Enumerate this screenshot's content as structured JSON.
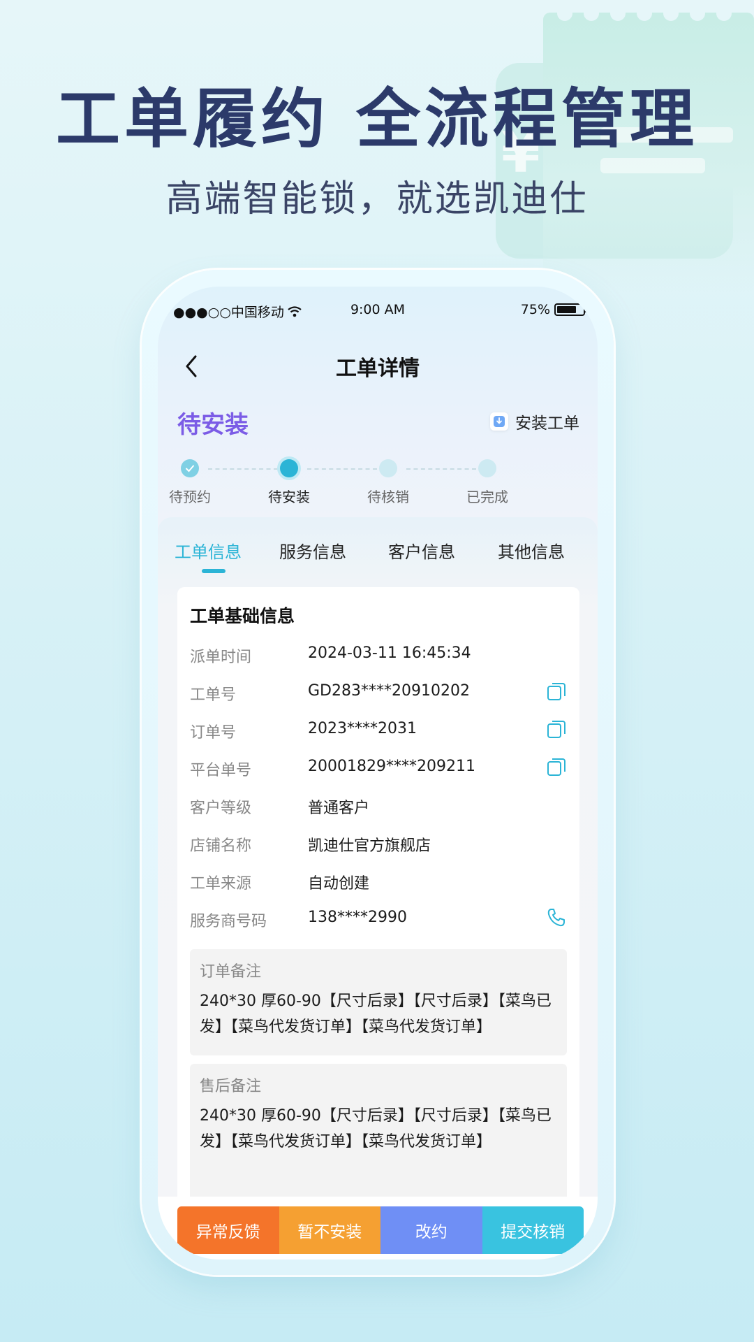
{
  "promo": {
    "headline": "工单履约  全流程管理",
    "subline": "高端智能锁，就选凯迪仕"
  },
  "status_bar": {
    "carrier": "●●●○○中国移动",
    "time": "9:00 AM",
    "battery": "75%",
    "battery_level": 0.75
  },
  "nav": {
    "title": "工单详情",
    "back_icon": "chevron-left-icon"
  },
  "order_status": {
    "title": "待安装",
    "type_label": "安装工单",
    "type_icon": "download-box-icon"
  },
  "steps": [
    {
      "label": "待预约",
      "state": "done"
    },
    {
      "label": "待安装",
      "state": "active"
    },
    {
      "label": "待核销",
      "state": "pending"
    },
    {
      "label": "已完成",
      "state": "pending"
    }
  ],
  "tabs": [
    {
      "label": "工单信息",
      "active": true
    },
    {
      "label": "服务信息",
      "active": false
    },
    {
      "label": "客户信息",
      "active": false
    },
    {
      "label": "其他信息",
      "active": false
    }
  ],
  "basic_info": {
    "title": "工单基础信息",
    "rows": [
      {
        "key": "派单时间",
        "value": "2024-03-11 16:45:34",
        "action": ""
      },
      {
        "key": "工单号",
        "value": "GD283****20910202",
        "action": "copy-icon"
      },
      {
        "key": "订单号",
        "value": "2023****2031",
        "action": "copy-icon"
      },
      {
        "key": "平台单号",
        "value": "20001829****209211",
        "action": "copy-icon"
      },
      {
        "key": "客户等级",
        "value": "普通客户",
        "action": ""
      },
      {
        "key": "店铺名称",
        "value": "凯迪仕官方旗舰店",
        "action": ""
      },
      {
        "key": "工单来源",
        "value": "自动创建",
        "action": ""
      },
      {
        "key": "服务商号码",
        "value": "138****2990",
        "action": "phone-icon"
      }
    ]
  },
  "notes": [
    {
      "title": "订单备注",
      "body": "240*30 厚60-90【尺寸后录】【尺寸后录】【菜鸟已发】【菜鸟代发货订单】【菜鸟代发货订单】"
    },
    {
      "title": "售后备注",
      "body": "240*30 厚60-90【尺寸后录】【尺寸后录】【菜鸟已发】【菜鸟代发货订单】【菜鸟代发货订单】"
    }
  ],
  "actions": [
    {
      "label": "异常反馈",
      "color": "#f4742a"
    },
    {
      "label": "暂不安装",
      "color": "#f5a032"
    },
    {
      "label": "改约",
      "color": "#6f8ff5"
    },
    {
      "label": "提交核销",
      "color": "#39c3e0"
    }
  ],
  "colors": {
    "accent": "#2bb4d6",
    "status_purple": "#7b5ce6",
    "headline": "#2c3a6a"
  }
}
